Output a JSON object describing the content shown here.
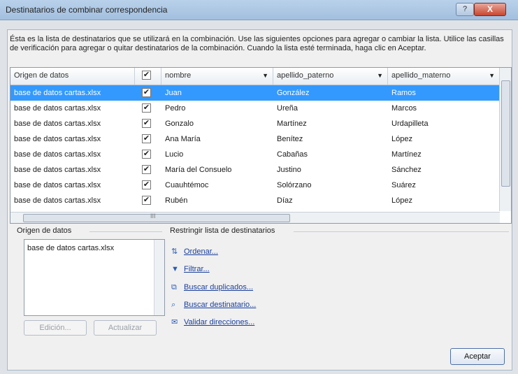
{
  "window": {
    "title": "Destinatarios de combinar correspondencia",
    "help_label": "?",
    "close_label": "X"
  },
  "instructions": "Ésta es la lista de destinatarios que se utilizará en la combinación. Use las siguientes opciones para agregar o cambiar la lista. Utilice las casillas de verificación para agregar o quitar destinatarios de la combinación. Cuando la lista esté terminada, haga clic en Aceptar.",
  "grid": {
    "headers": [
      "Origen de datos",
      "✔",
      "nombre",
      "apellido_paterno",
      "apellido_materno"
    ],
    "rows": [
      {
        "source": "base de datos cartas.xlsx",
        "checked": "✔",
        "nombre": "Juan",
        "paterno": "González",
        "materno": "Ramos"
      },
      {
        "source": "base de datos cartas.xlsx",
        "checked": "✔",
        "nombre": "Pedro",
        "paterno": "Ureña",
        "materno": "Marcos"
      },
      {
        "source": "base de datos cartas.xlsx",
        "checked": "✔",
        "nombre": "Gonzalo",
        "paterno": "Martínez",
        "materno": "Urdapilleta"
      },
      {
        "source": "base de datos cartas.xlsx",
        "checked": "✔",
        "nombre": "Ana María",
        "paterno": "Benítez",
        "materno": "López"
      },
      {
        "source": "base de datos cartas.xlsx",
        "checked": "✔",
        "nombre": "Lucio",
        "paterno": "Cabañas",
        "materno": "Martínez"
      },
      {
        "source": "base de datos cartas.xlsx",
        "checked": "✔",
        "nombre": "María del Consuelo",
        "paterno": "Justino",
        "materno": "Sánchez"
      },
      {
        "source": "base de datos cartas.xlsx",
        "checked": "✔",
        "nombre": "Cuauhtémoc",
        "paterno": "Solórzano",
        "materno": "Suárez"
      },
      {
        "source": "base de datos cartas.xlsx",
        "checked": "✔",
        "nombre": "Rubén",
        "paterno": "Díaz",
        "materno": "López"
      }
    ],
    "scroll_marker": "III"
  },
  "data_source": {
    "label": "Origen de datos",
    "items": [
      "base de datos cartas.xlsx"
    ],
    "edit_button": "Edición...",
    "refresh_button": "Actualizar"
  },
  "refine": {
    "label": "Restringir lista de destinatarios",
    "links": [
      "Ordenar...",
      "Filtrar...",
      "Buscar duplicados...",
      "Buscar destinatario...",
      "Validar direcciones..."
    ]
  },
  "ok_button": "Aceptar",
  "colors": {
    "selection": "#3399ff",
    "link": "#1a3f9c",
    "titlebar": "#a3bfdf"
  }
}
